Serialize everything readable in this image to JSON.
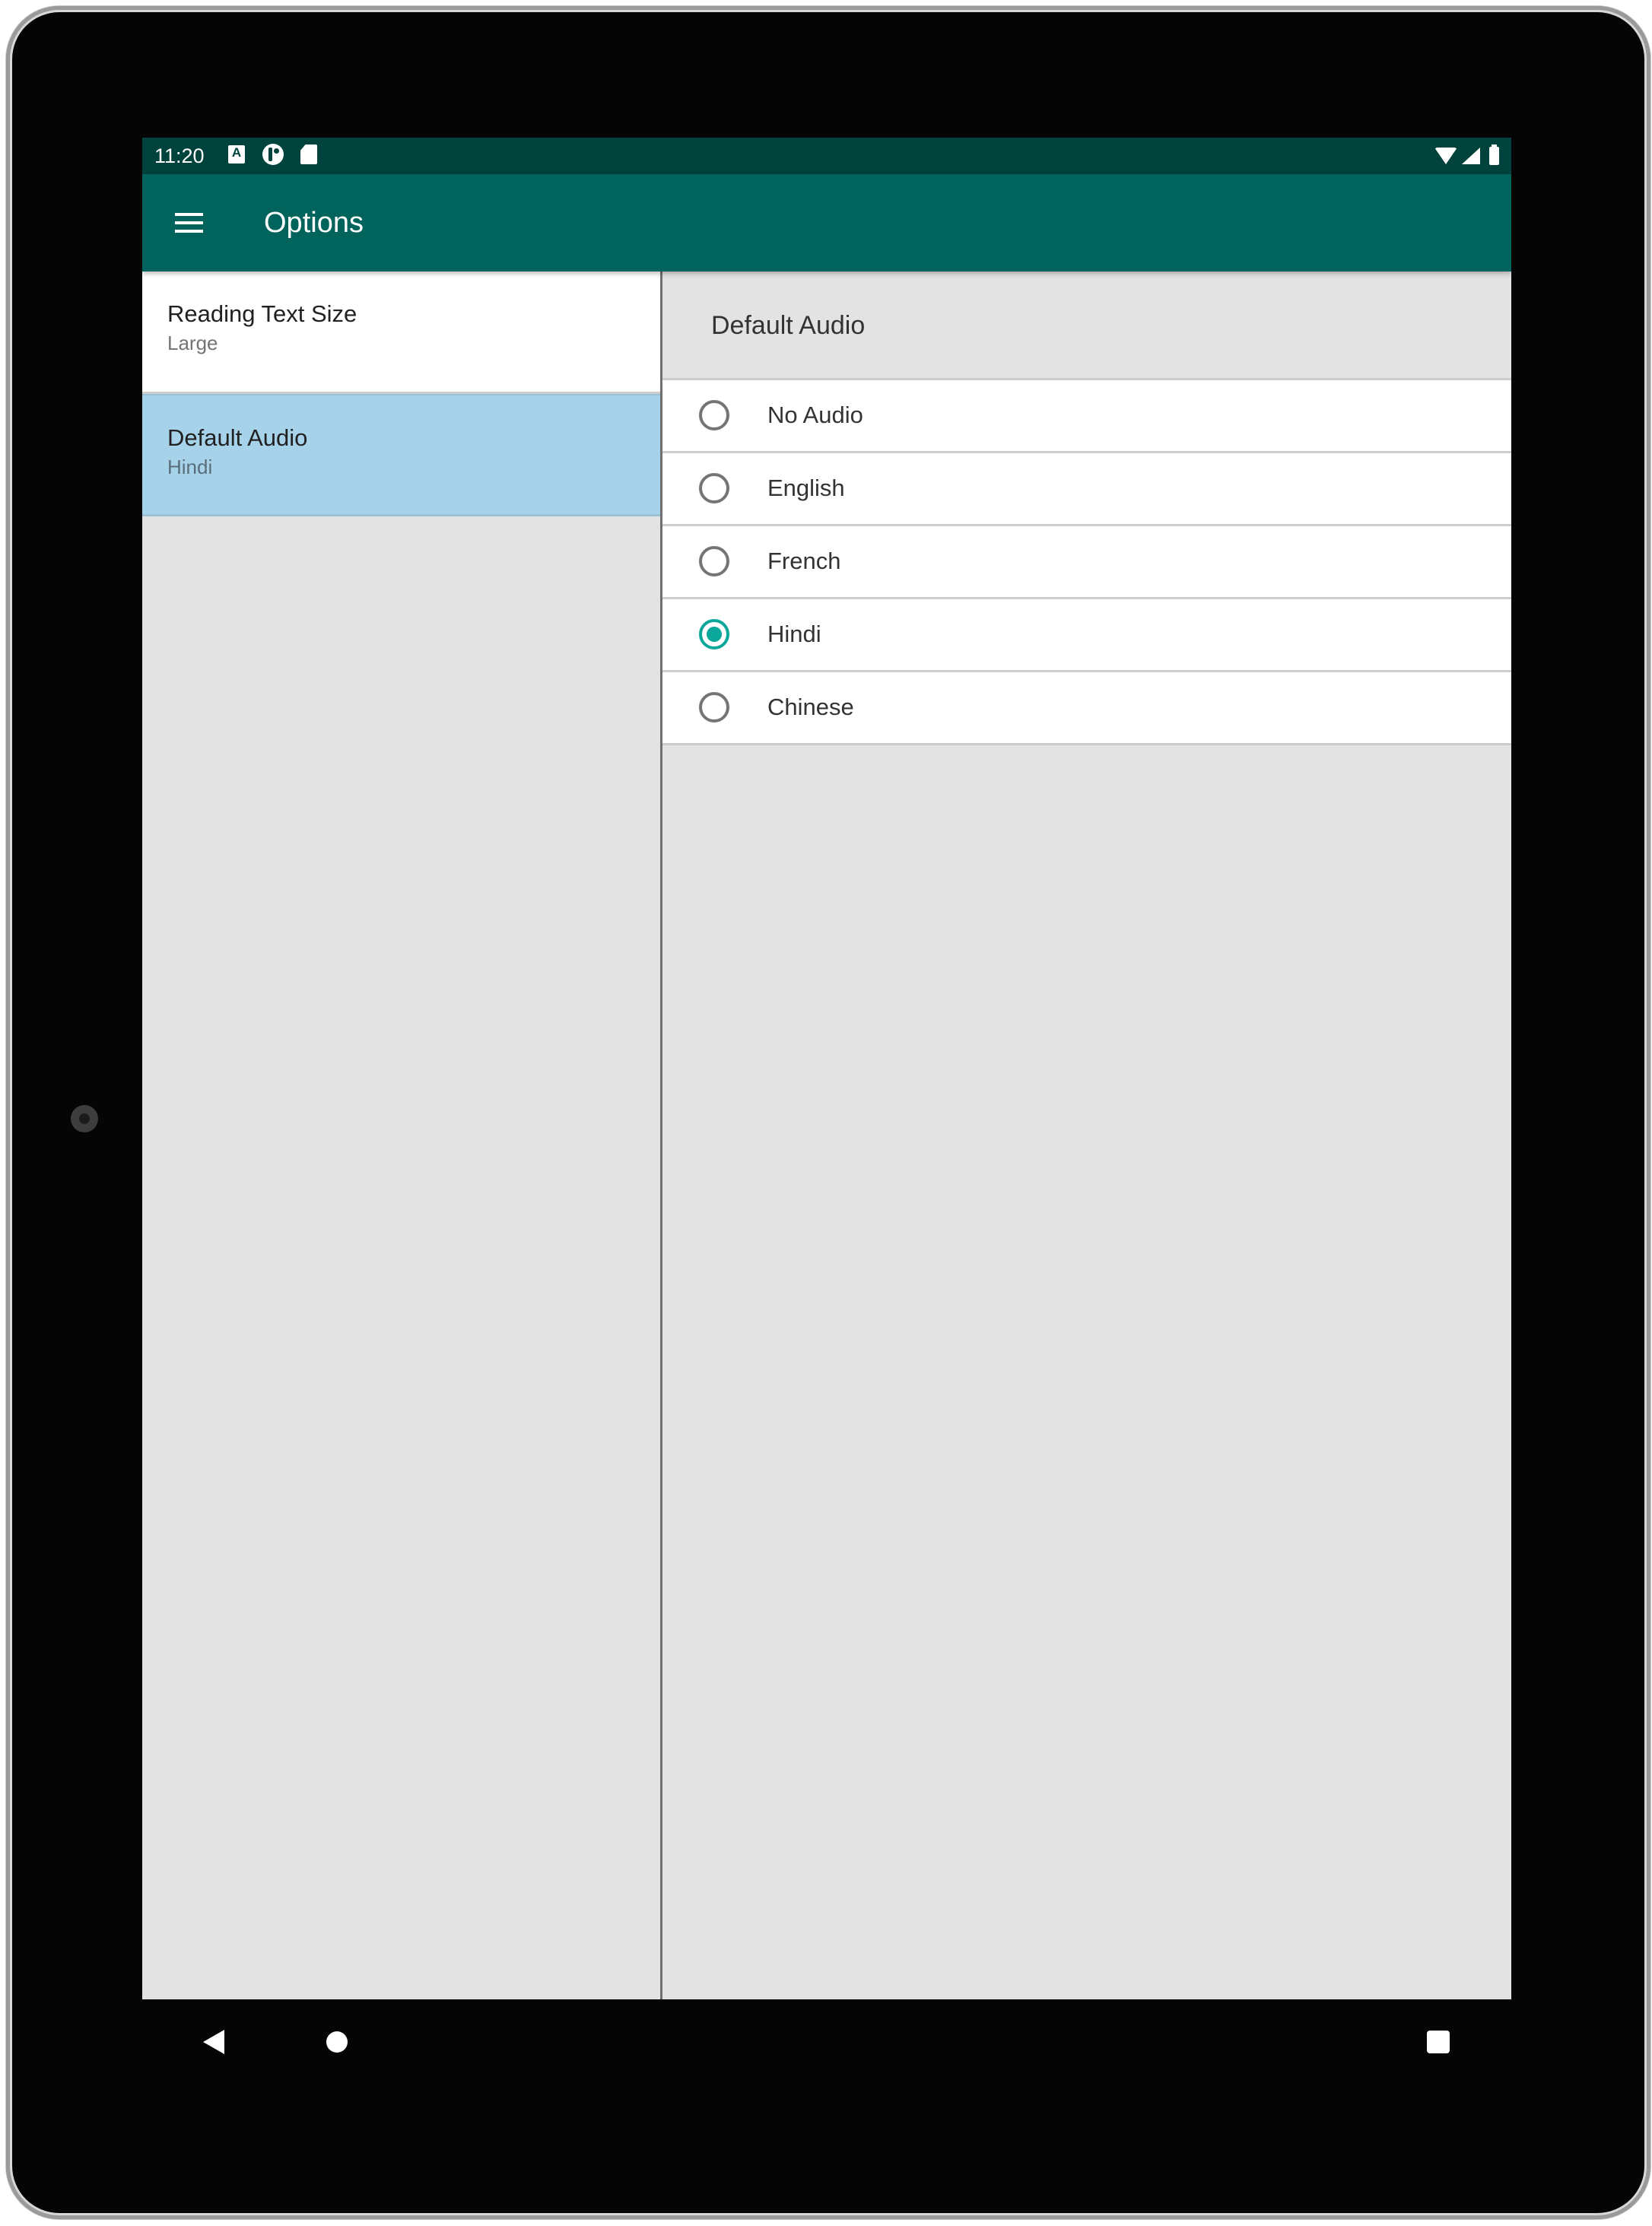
{
  "status_bar": {
    "time": "11:20",
    "left_icons": [
      "accessibility-a-icon",
      "app-notification-icon",
      "sd-card-icon"
    ],
    "right_icons": [
      "wifi-icon",
      "cell-signal-icon",
      "battery-icon"
    ],
    "a_glyph": "A"
  },
  "app_bar": {
    "title": "Options",
    "menu_icon": "hamburger-menu-icon"
  },
  "preferences": [
    {
      "title": "Reading Text Size",
      "summary": "Large",
      "selected": false
    },
    {
      "title": "Default Audio",
      "summary": "Hindi",
      "selected": true
    }
  ],
  "dialog": {
    "title": "Default Audio",
    "options": [
      {
        "label": "No Audio",
        "checked": false
      },
      {
        "label": "English",
        "checked": false
      },
      {
        "label": "French",
        "checked": false
      },
      {
        "label": "Hindi",
        "checked": true
      },
      {
        "label": "Chinese",
        "checked": false
      }
    ],
    "selected_value": "Hindi"
  },
  "nav_bar": {
    "buttons": [
      "back",
      "home",
      "recents"
    ]
  },
  "colors": {
    "status_bar": "#00423c",
    "app_bar": "#00645c",
    "accent": "#0aa79a",
    "selected_item": "#a6d2ea",
    "background": "#e3e3e3"
  }
}
